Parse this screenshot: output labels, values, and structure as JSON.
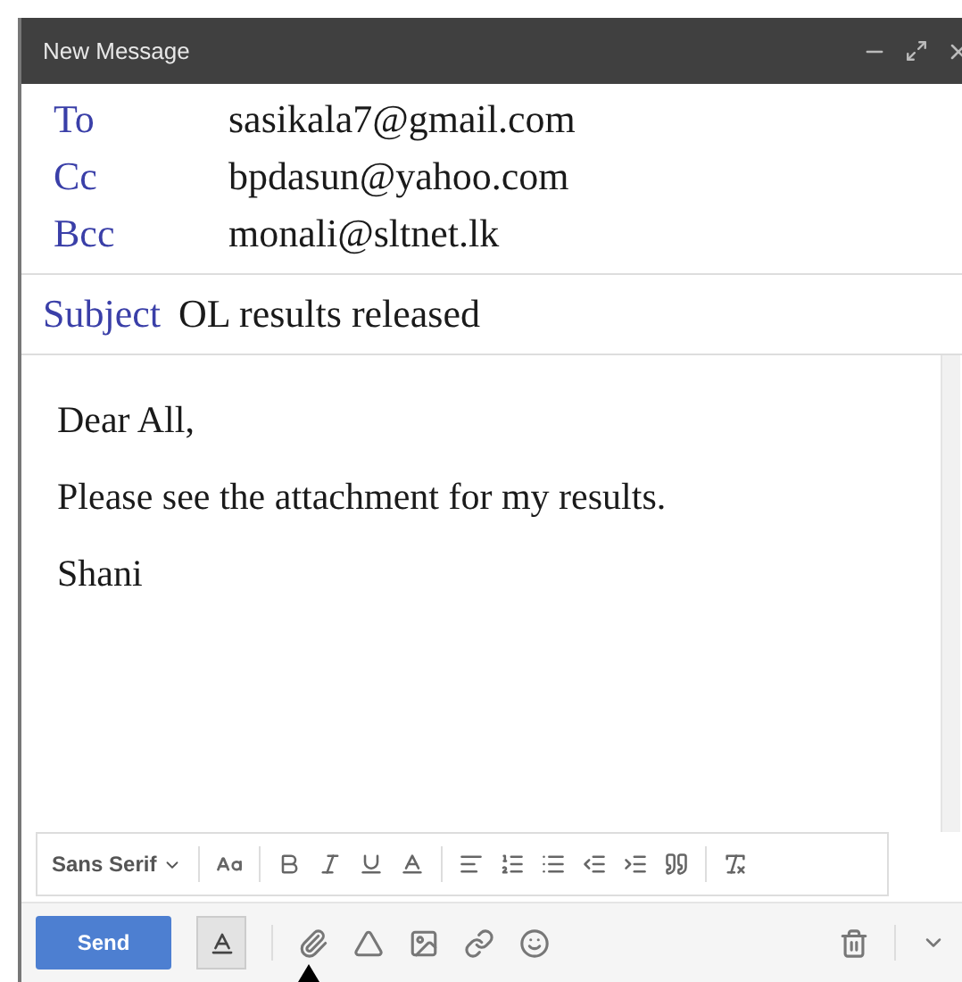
{
  "window": {
    "title": "New Message"
  },
  "recipients": [
    {
      "label": "To",
      "value": "sasikala7@gmail.com"
    },
    {
      "label": "Cc",
      "value": "bpdasun@yahoo.com"
    },
    {
      "label": "Bcc",
      "value": "monali@sltnet.lk"
    }
  ],
  "subject": {
    "label": "Subject",
    "value": "OL results released"
  },
  "body": [
    "Dear All,",
    "Please see the attachment for my results.",
    "Shani"
  ],
  "format_toolbar": {
    "font": "Sans Serif"
  },
  "send_button": "Send"
}
